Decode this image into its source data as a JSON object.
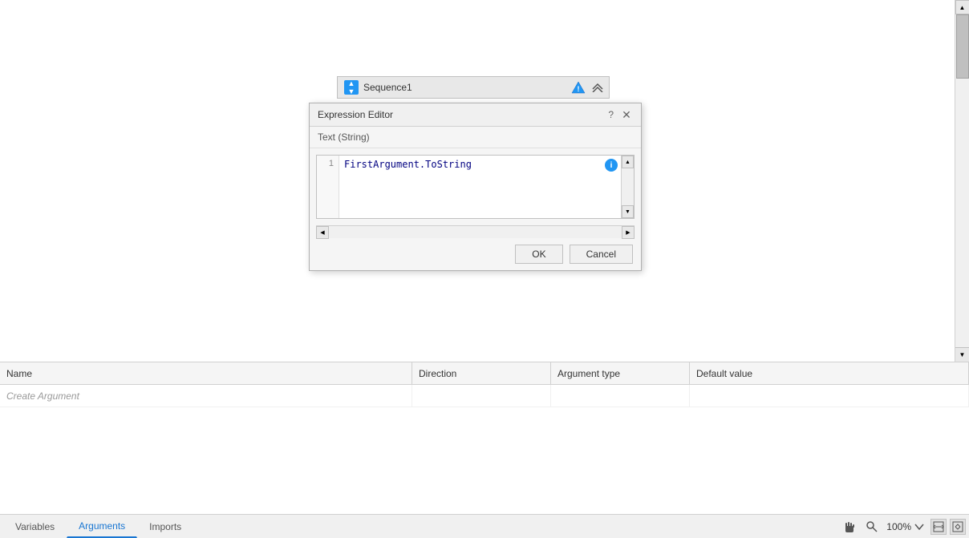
{
  "canvas": {
    "background": "#ffffff"
  },
  "sequence": {
    "title": "Sequence1",
    "icon_label": "↕"
  },
  "dialog": {
    "title": "Expression Editor",
    "help_label": "?",
    "close_label": "✕",
    "subtitle": "Text (String)",
    "line_number": "1",
    "editor_content": "FirstArgument.ToString",
    "ok_button": "OK",
    "cancel_button": "Cancel"
  },
  "table": {
    "columns": {
      "name": "Name",
      "direction": "Direction",
      "argument_type": "Argument type",
      "default_value": "Default value"
    },
    "placeholder_row": "Create Argument"
  },
  "bottom_tabs": {
    "variables_label": "Variables",
    "arguments_label": "Arguments",
    "imports_label": "Imports"
  },
  "status_bar": {
    "zoom_value": "100%",
    "hand_icon": "✋",
    "search_icon": "🔍",
    "fit_width_icon": "⊞",
    "fit_page_icon": "⊟"
  }
}
